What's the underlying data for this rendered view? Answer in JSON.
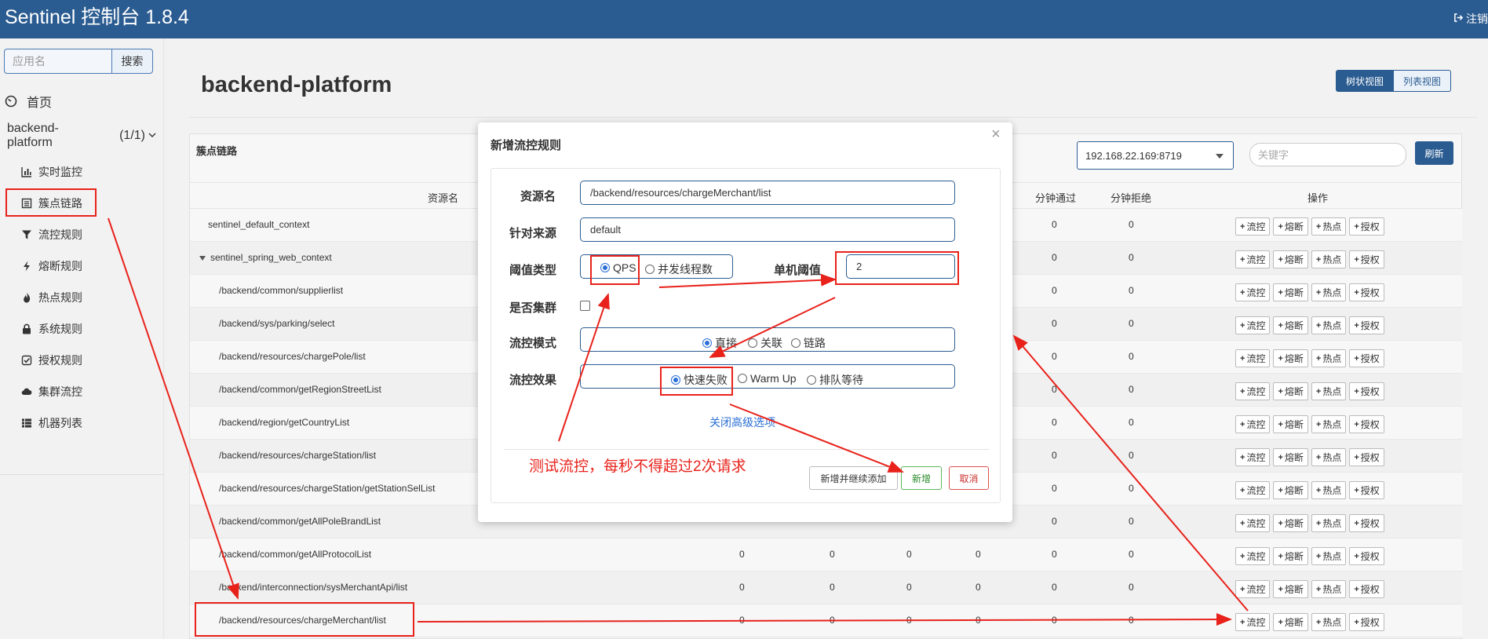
{
  "app": {
    "title": "Sentinel 控制台 1.8.4",
    "logout_label": "注销"
  },
  "sidebar": {
    "search_placeholder": "应用名",
    "search_button": "搜索",
    "home_label": "首页",
    "app_name": "backend-platform",
    "app_count": "(1/1)",
    "items": [
      {
        "label": "实时监控",
        "icon": "bar-chart-icon"
      },
      {
        "label": "簇点链路",
        "icon": "list-icon"
      },
      {
        "label": "流控规则",
        "icon": "filter-icon"
      },
      {
        "label": "熔断规则",
        "icon": "flash-icon"
      },
      {
        "label": "热点规则",
        "icon": "fire-icon"
      },
      {
        "label": "系统规则",
        "icon": "lock-icon"
      },
      {
        "label": "授权规则",
        "icon": "check-square-icon"
      },
      {
        "label": "集群流控",
        "icon": "cloud-icon"
      },
      {
        "label": "机器列表",
        "icon": "th-list-icon"
      }
    ]
  },
  "main": {
    "page_title": "backend-platform",
    "view_tree": "树状视图",
    "view_list": "列表视图",
    "panel_title": "簇点链路",
    "machine_select": "192.168.22.169:8719",
    "keyword_placeholder": "关键字",
    "refresh_button": "刷新",
    "columns": {
      "resource": "资源名",
      "pass_min": "分钟通过",
      "block_min": "分钟拒绝",
      "ops": "操作"
    },
    "op_buttons": [
      "流控",
      "熔断",
      "热点",
      "授权"
    ],
    "rows": [
      {
        "name": "sentinel_default_context",
        "indent": 0,
        "expand": false,
        "v1": "",
        "v2": "",
        "v3": "",
        "v4": "",
        "pass": "0",
        "block": "0"
      },
      {
        "name": "sentinel_spring_web_context",
        "indent": 0,
        "expand": true,
        "v1": "",
        "v2": "",
        "v3": "",
        "v4": "",
        "pass": "0",
        "block": "0"
      },
      {
        "name": "/backend/common/supplierlist",
        "indent": 1,
        "expand": false,
        "v1": "",
        "v2": "",
        "v3": "",
        "v4": "",
        "pass": "0",
        "block": "0"
      },
      {
        "name": "/backend/sys/parking/select",
        "indent": 1,
        "expand": false,
        "v1": "",
        "v2": "",
        "v3": "",
        "v4": "",
        "pass": "0",
        "block": "0"
      },
      {
        "name": "/backend/resources/chargePole/list",
        "indent": 1,
        "expand": false,
        "v1": "",
        "v2": "",
        "v3": "",
        "v4": "",
        "pass": "0",
        "block": "0"
      },
      {
        "name": "/backend/common/getRegionStreetList",
        "indent": 1,
        "expand": false,
        "v1": "",
        "v2": "",
        "v3": "",
        "v4": "",
        "pass": "0",
        "block": "0"
      },
      {
        "name": "/backend/region/getCountryList",
        "indent": 1,
        "expand": false,
        "v1": "",
        "v2": "",
        "v3": "",
        "v4": "",
        "pass": "0",
        "block": "0"
      },
      {
        "name": "/backend/resources/chargeStation/list",
        "indent": 1,
        "expand": false,
        "v1": "",
        "v2": "",
        "v3": "",
        "v4": "",
        "pass": "0",
        "block": "0"
      },
      {
        "name": "/backend/resources/chargeStation/getStationSelList",
        "indent": 1,
        "expand": false,
        "v1": "",
        "v2": "",
        "v3": "",
        "v4": "",
        "pass": "0",
        "block": "0"
      },
      {
        "name": "/backend/common/getAllPoleBrandList",
        "indent": 1,
        "expand": false,
        "v1": "",
        "v2": "",
        "v3": "",
        "v4": "",
        "pass": "0",
        "block": "0"
      },
      {
        "name": "/backend/common/getAllProtocolList",
        "indent": 1,
        "expand": false,
        "v1": "0",
        "v2": "0",
        "v3": "0",
        "v4": "0",
        "pass": "0",
        "block": "0"
      },
      {
        "name": "/backend/interconnection/sysMerchantApi/list",
        "indent": 1,
        "expand": false,
        "v1": "0",
        "v2": "0",
        "v3": "0",
        "v4": "0",
        "pass": "0",
        "block": "0"
      },
      {
        "name": "/backend/resources/chargeMerchant/list",
        "indent": 1,
        "expand": false,
        "v1": "0",
        "v2": "0",
        "v3": "0",
        "v4": "0",
        "pass": "0",
        "block": "0"
      }
    ]
  },
  "modal": {
    "title": "新增流控规则",
    "close_glyph": "×",
    "resource_label": "资源名",
    "resource_value": "/backend/resources/chargeMerchant/list",
    "origin_label": "针对来源",
    "origin_value": "default",
    "threshold_type_label": "阈值类型",
    "threshold_type_qps": "QPS",
    "threshold_type_thread": "并发线程数",
    "single_threshold_label": "单机阈值",
    "single_threshold_value": "2",
    "cluster_label": "是否集群",
    "mode_label": "流控模式",
    "mode_direct": "直接",
    "mode_relate": "关联",
    "mode_chain": "链路",
    "effect_label": "流控效果",
    "effect_fail": "快速失败",
    "effect_warmup": "Warm Up",
    "effect_queue": "排队等待",
    "advanced_link": "关闭高级选项",
    "btn_add_continue": "新增并继续添加",
    "btn_add": "新增",
    "btn_cancel": "取消"
  },
  "annotation": {
    "text": "测试流控，每秒不得超过2次请求",
    "color": "#e8221b"
  },
  "colors": {
    "header": "#2b5c91",
    "accent": "#2a6fd6",
    "annotation": "#e8221b"
  }
}
